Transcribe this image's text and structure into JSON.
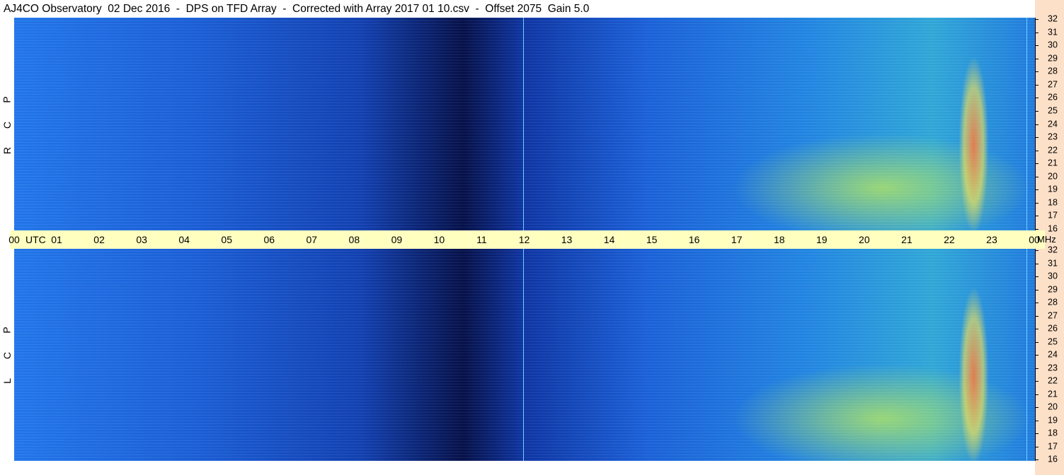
{
  "title": "AJ4CO Observatory  02 Dec 2016  -  DPS on TFD Array  -  Corrected with Array 2017 01 10.csv  -  Offset 2075  Gain 5.0",
  "colors": {
    "background": "#ffffff",
    "time_axis_bg": "#ffffc0",
    "freq_axis_bg": "#fde0c8",
    "spectrogram_low": "#05104a",
    "spectrogram_mid": "#1b5fd8",
    "spectrogram_high": "#ff5030"
  },
  "chart_data": {
    "type": "heatmap",
    "x": {
      "unit_label": "UTC",
      "ticks": [
        "00",
        "01",
        "02",
        "03",
        "04",
        "05",
        "06",
        "07",
        "08",
        "09",
        "10",
        "11",
        "12",
        "13",
        "14",
        "15",
        "16",
        "17",
        "18",
        "19",
        "20",
        "21",
        "22",
        "23",
        "00"
      ],
      "range": [
        0,
        24
      ]
    },
    "y": {
      "unit_label": "MHz",
      "ticks": [
        "32",
        "31",
        "30",
        "29",
        "28",
        "27",
        "26",
        "25",
        "24",
        "23",
        "22",
        "21",
        "20",
        "19",
        "18",
        "17",
        "16"
      ],
      "range": [
        16,
        32
      ]
    },
    "panels": [
      {
        "label_letters": [
          "P",
          "C",
          "R"
        ]
      },
      {
        "label_letters": [
          "P",
          "C",
          "L"
        ]
      }
    ]
  }
}
